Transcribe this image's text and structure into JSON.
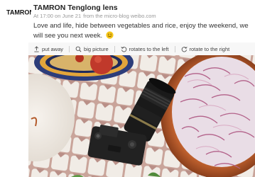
{
  "post": {
    "avatar_text": "TAMRON",
    "author": "TAMRON Tenglong lens",
    "time": "At 17:00 on June 21",
    "source": "from the micro-blog weibo.com",
    "text": "Love and life, hide between vegetables and rice, enjoy the weekend, we will see you next week."
  },
  "toolbar": {
    "put_away": "put away",
    "big_picture": "big picture",
    "rotate_left": "rotates to the left",
    "rotate_right": "rotate to the right"
  }
}
